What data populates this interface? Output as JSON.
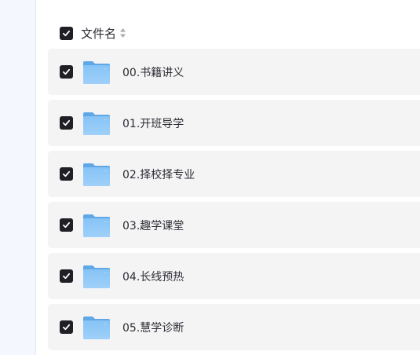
{
  "header": {
    "column_label": "文件名",
    "sort_icon": "sort-arrows-icon"
  },
  "files": [
    {
      "name": "00.书籍讲义",
      "checked": true,
      "icon": "folder-icon"
    },
    {
      "name": "01.开班导学",
      "checked": true,
      "icon": "folder-icon"
    },
    {
      "name": "02.择校择专业",
      "checked": true,
      "icon": "folder-icon"
    },
    {
      "name": "03.趣学课堂",
      "checked": true,
      "icon": "folder-icon"
    },
    {
      "name": "04.长线预热",
      "checked": true,
      "icon": "folder-icon"
    },
    {
      "name": "05.慧学诊断",
      "checked": true,
      "icon": "folder-icon"
    }
  ],
  "colors": {
    "checkbox_fill": "#1f1f25",
    "row_background": "#f4f4f5",
    "folder_blue": "#7cbcf3",
    "side_rail": "#f4f7fd"
  }
}
